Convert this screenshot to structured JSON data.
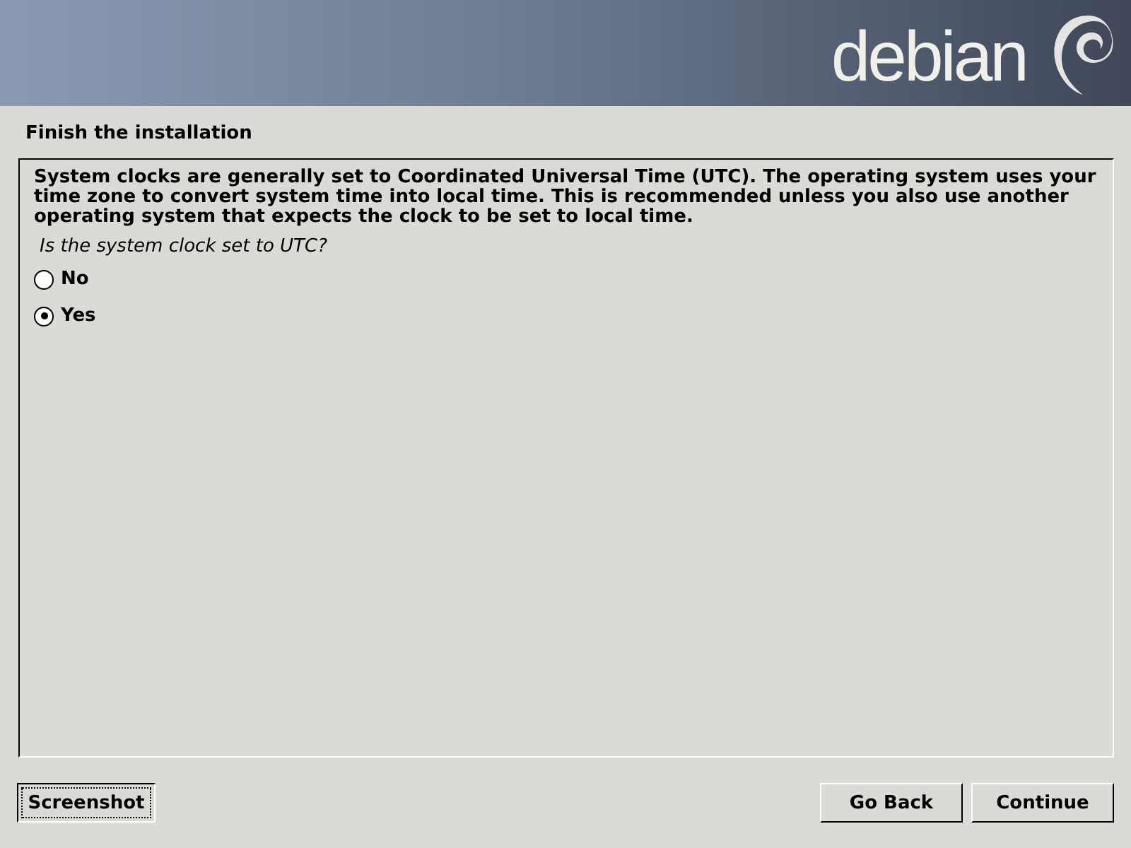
{
  "banner": {
    "logo_text": "debian"
  },
  "title": "Finish the installation",
  "description": "System clocks are generally set to Coordinated Universal Time (UTC). The operating system uses your time zone to convert system time into local time. This is recommended unless you also use another operating system that expects the clock to be set to local time.",
  "question": "Is the system clock set to UTC?",
  "options": [
    {
      "label": "No",
      "selected": false
    },
    {
      "label": "Yes",
      "selected": true
    }
  ],
  "buttons": [
    {
      "label": "Screenshot",
      "focused": true
    },
    {
      "label": "Go Back",
      "focused": false
    },
    {
      "label": "Continue",
      "focused": false
    }
  ]
}
